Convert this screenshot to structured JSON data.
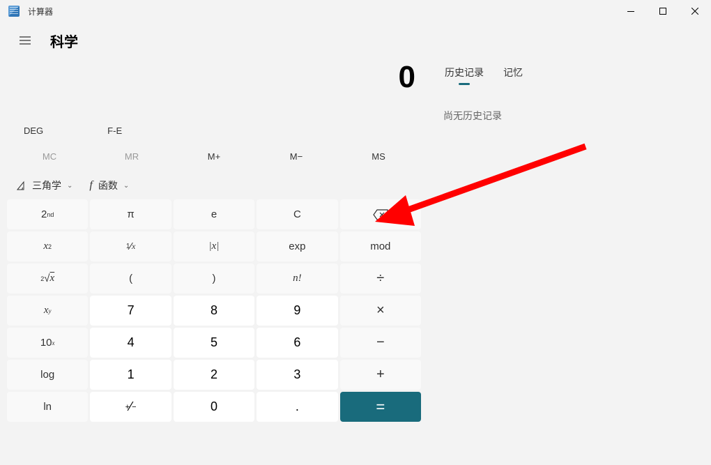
{
  "titlebar": {
    "title": "计算器"
  },
  "header": {
    "mode": "科学"
  },
  "display": {
    "result": "0"
  },
  "toggles": {
    "deg": "DEG",
    "fe": "F-E"
  },
  "memory": {
    "mc": "MC",
    "mr": "MR",
    "mplus": "M+",
    "mminus": "M−",
    "ms": "MS"
  },
  "funcrow": {
    "trig": "三角学",
    "func": "函数"
  },
  "sidebar": {
    "tabs": {
      "history": "历史记录",
      "memory": "记忆"
    },
    "empty": "尚无历史记录"
  },
  "keys": {
    "second": "2",
    "second_sup": "nd",
    "pi": "π",
    "e": "e",
    "c": "C",
    "xsq_base": "x",
    "xsq_sup": "2",
    "recip_num": "1",
    "recip_sep": "⁄",
    "recip_den": "x",
    "abs": "|x|",
    "exp": "exp",
    "mod": "mod",
    "sqrt_pre": "2",
    "sqrt": "√",
    "sqrt_x": "x",
    "lparen": "(",
    "rparen": ")",
    "fact": "n!",
    "div": "÷",
    "xy_base": "x",
    "xy_sup": "y",
    "n7": "7",
    "n8": "8",
    "n9": "9",
    "mul": "×",
    "tenx_base": "10",
    "tenx_sup": "x",
    "n4": "4",
    "n5": "5",
    "n6": "6",
    "sub": "−",
    "log": "log",
    "n1": "1",
    "n2": "2",
    "n3": "3",
    "add": "+",
    "ln": "ln",
    "pm_plus": "+",
    "pm_sep": "⁄",
    "pm_minus": "−",
    "n0": "0",
    "dot": ".",
    "eq": "="
  }
}
